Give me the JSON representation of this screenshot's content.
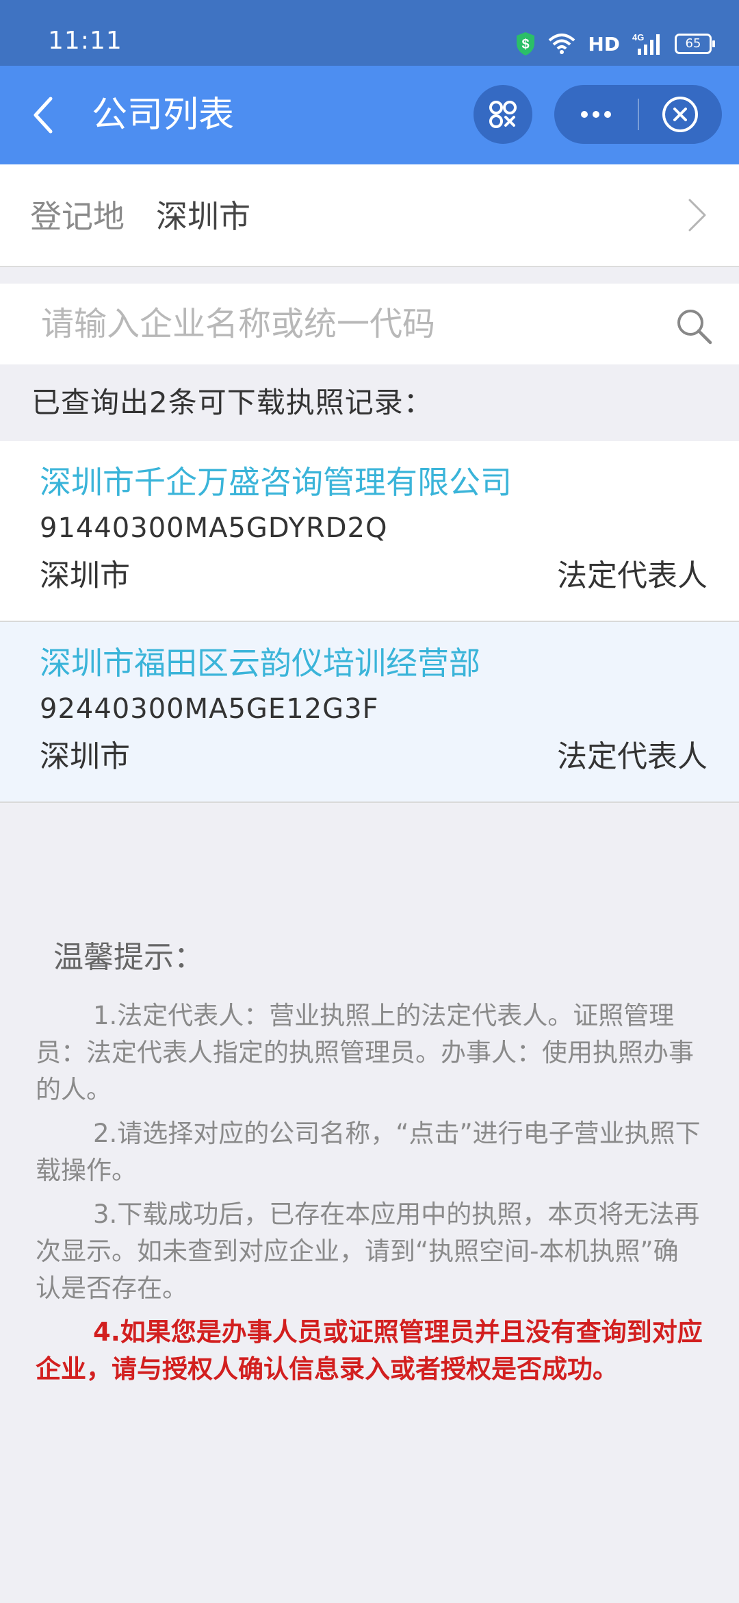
{
  "status_bar": {
    "time": "11:11",
    "network_label": "HD",
    "signal_label": "4G",
    "battery": "65"
  },
  "nav": {
    "title": "公司列表"
  },
  "registration": {
    "label": "登记地",
    "value": "深圳市"
  },
  "search": {
    "placeholder": "请输入企业名称或统一代码"
  },
  "results": {
    "summary": "已查询出2条可下载执照记录：",
    "items": [
      {
        "name": "深圳市千企万盛咨询管理有限公司",
        "code": "91440300MA5GDYRD2Q",
        "city": "深圳市",
        "role": "法定代表人"
      },
      {
        "name": "深圳市福田区云韵仪培训经营部",
        "code": "92440300MA5GE12G3F",
        "city": "深圳市",
        "role": "法定代表人"
      }
    ]
  },
  "tips": {
    "title": "温馨提示：",
    "items": [
      "1.法定代表人：营业执照上的法定代表人。证照管理员：法定代表人指定的执照管理员。办事人：使用执照办事的人。",
      "2.请选择对应的公司名称，“点击”进行电子营业执照下载操作。",
      "3.下载成功后，已存在本应用中的执照，本页将无法再次显示。如未查到对应企业，请到“执照空间-本机执照”确认是否存在。",
      "4.如果您是办事人员或证照管理员并且没有查询到对应企业，请与授权人确认信息录入或者授权是否成功。"
    ]
  },
  "colors": {
    "status_bar": "#3f73c2",
    "nav_bar": "#4d8ef1",
    "company_name": "#3ab4d9",
    "warning_text": "#d21f1f"
  }
}
